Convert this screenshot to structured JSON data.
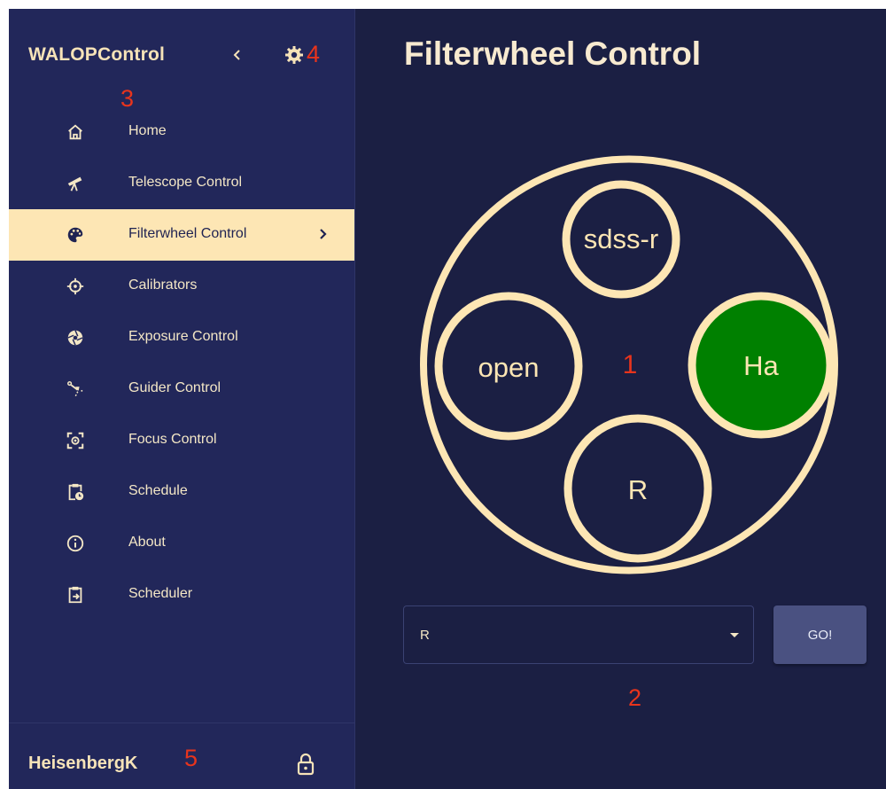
{
  "sidebar": {
    "brand": "WALOPControl",
    "collapse_icon": "chevron-left-icon",
    "settings_icon": "gear-icon",
    "items": [
      {
        "label": "Home",
        "icon": "home-icon"
      },
      {
        "label": "Telescope Control",
        "icon": "telescope-icon"
      },
      {
        "label": "Filterwheel Control",
        "icon": "palette-icon",
        "active": true
      },
      {
        "label": "Calibrators",
        "icon": "crosshair-icon"
      },
      {
        "label": "Exposure Control",
        "icon": "aperture-icon"
      },
      {
        "label": "Guider Control",
        "icon": "satellite-dish-icon"
      },
      {
        "label": "Focus Control",
        "icon": "center-focus-icon"
      },
      {
        "label": "Schedule",
        "icon": "clipboard-clock-icon"
      },
      {
        "label": "About",
        "icon": "info-icon"
      },
      {
        "label": "Scheduler",
        "icon": "clipboard-arrow-icon"
      }
    ],
    "user": "HeisenbergK",
    "lock_icon": "lock-icon"
  },
  "main": {
    "title": "Filterwheel Control",
    "wheel": {
      "slots": [
        {
          "label": "sdss-r",
          "position": "top",
          "active": false
        },
        {
          "label": "open",
          "position": "left",
          "active": false
        },
        {
          "label": "Ha",
          "position": "right",
          "active": true
        },
        {
          "label": "R",
          "position": "bottom",
          "active": false
        }
      ]
    },
    "select": {
      "value": "R"
    },
    "go_label": "GO!"
  },
  "annotations": [
    "1",
    "2",
    "3",
    "4",
    "5"
  ],
  "colors": {
    "background": "#1b1f43",
    "sidebar": "#22275a",
    "accent": "#fde6b4",
    "active_filter": "#008000",
    "annotation": "#e8341c",
    "button": "#4a5181"
  }
}
